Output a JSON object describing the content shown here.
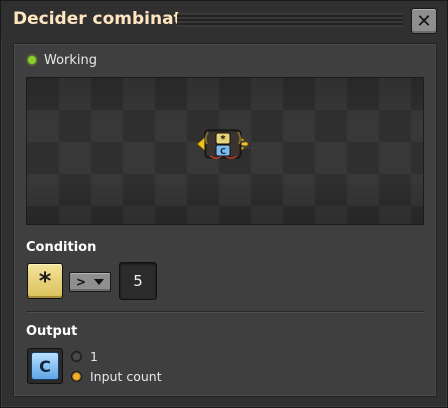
{
  "window": {
    "title": "Decider combinator",
    "close_glyph": "✕"
  },
  "status": {
    "text": "Working",
    "color": "#8bd02a"
  },
  "preview": {
    "entity_icon": "decider-combinator-icon",
    "entity_badges": [
      "*",
      "C"
    ]
  },
  "condition": {
    "label": "Condition",
    "first_signal": {
      "icon": "signal-each-icon",
      "glyph": "*"
    },
    "comparator": ">",
    "constant": "5"
  },
  "output": {
    "label": "Output",
    "signal": {
      "icon": "signal-C-icon",
      "glyph": "C"
    },
    "options": [
      {
        "label": "1",
        "selected": false
      },
      {
        "label": "Input count",
        "selected": true
      }
    ]
  }
}
